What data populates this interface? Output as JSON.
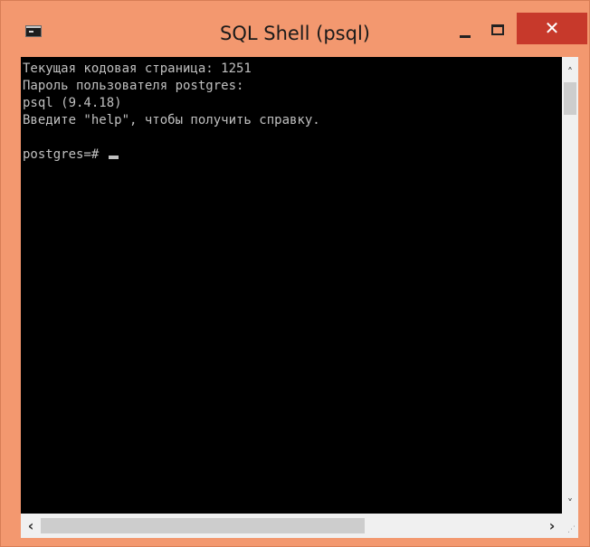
{
  "window": {
    "title": "SQL Shell (psql)",
    "icon": "console-icon",
    "close_glyph": "✕",
    "accent": "#f3986f",
    "close_color": "#c7392b"
  },
  "console": {
    "lines": [
      "Текущая кодовая страница: 1251",
      "Пароль пользователя postgres:",
      "psql (9.4.18)",
      "Введите \"help\", чтобы получить справку.",
      ""
    ],
    "prompt": "postgres=# ",
    "text_color": "#c0c0c0",
    "background": "#000000"
  },
  "scrollbars": {
    "up_glyph": "˄",
    "down_glyph": "˅",
    "left_glyph": "‹",
    "right_glyph": "›",
    "grip_glyph": "⋰"
  }
}
